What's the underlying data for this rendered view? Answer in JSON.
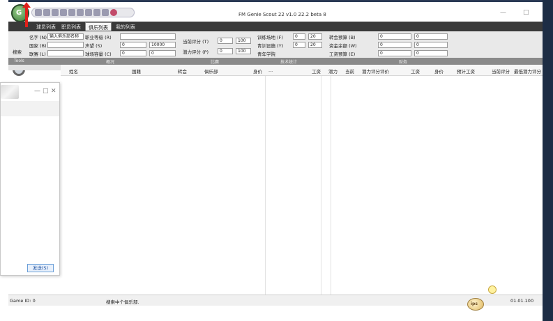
{
  "window": {
    "title": "FM Genie Scout 22 v1.0 22.2 beta 8",
    "minimize": "—",
    "maximize": "□"
  },
  "logo": {
    "text": "G"
  },
  "tabs": [
    {
      "label": "球员列表"
    },
    {
      "label": "职员列表"
    },
    {
      "label": "俱乐列表"
    },
    {
      "label": "我的列表"
    }
  ],
  "toolbar": {
    "search_label": "搜索",
    "tools_group": "Tools",
    "group1": "概况",
    "group2": "比赛",
    "group3": "技术统计",
    "group4": "财务",
    "rows": [
      {
        "label": "名字 (N)",
        "value": "输入俱乐部名称",
        "extra_label": "职业等级 (R)",
        "extra_value": ""
      },
      {
        "label": "国家 (B)",
        "value": "",
        "extra_label": "声望 (S)",
        "min": "0",
        "max": "10000"
      },
      {
        "label": "联赛 (L)",
        "value": "",
        "extra_label": "球场容量 (C)",
        "min": "0",
        "max": "0"
      }
    ],
    "match": [
      {
        "label": "当前评分 (T)",
        "min": "0",
        "max": "100"
      },
      {
        "label": "潜力评分 (P)",
        "min": "0",
        "max": "100"
      }
    ],
    "stats": [
      {
        "label": "训练场地 (F)",
        "min": "0",
        "max": "20"
      },
      {
        "label": "青训设施 (Y)",
        "min": "0",
        "max": "20"
      },
      {
        "label": "青年学院",
        "min": "",
        "max": ""
      }
    ],
    "finance": [
      {
        "label": "转会预算 (B)",
        "min": "0",
        "max": "0"
      },
      {
        "label": "资金余额 (W)",
        "min": "0",
        "max": "0"
      },
      {
        "label": "工资预算 (E)",
        "min": "0",
        "max": "0"
      }
    ]
  },
  "columns": [
    "姓名",
    "国籍",
    "转会",
    "俱乐部",
    "身价",
    "...",
    "工资",
    "潜力",
    "当前",
    "潜力评分",
    "评价",
    "工资",
    "身价",
    "预计工资",
    "当前评分",
    "最低潜力评分"
  ],
  "subwindow": {
    "send_button": "发送(S)",
    "minimize": "—",
    "maximize": "□",
    "close": "✕"
  },
  "status": {
    "left": "Game ID: 0",
    "middle": "搜索中个俱乐部.",
    "right": "01.01.100"
  },
  "tips": {
    "label": "ips"
  },
  "colors": {
    "tabrow": "#3a3a3a",
    "toolbar": "#e9e9e9",
    "accent_arrow": "#e0201a",
    "frame": "#1d2d45"
  }
}
